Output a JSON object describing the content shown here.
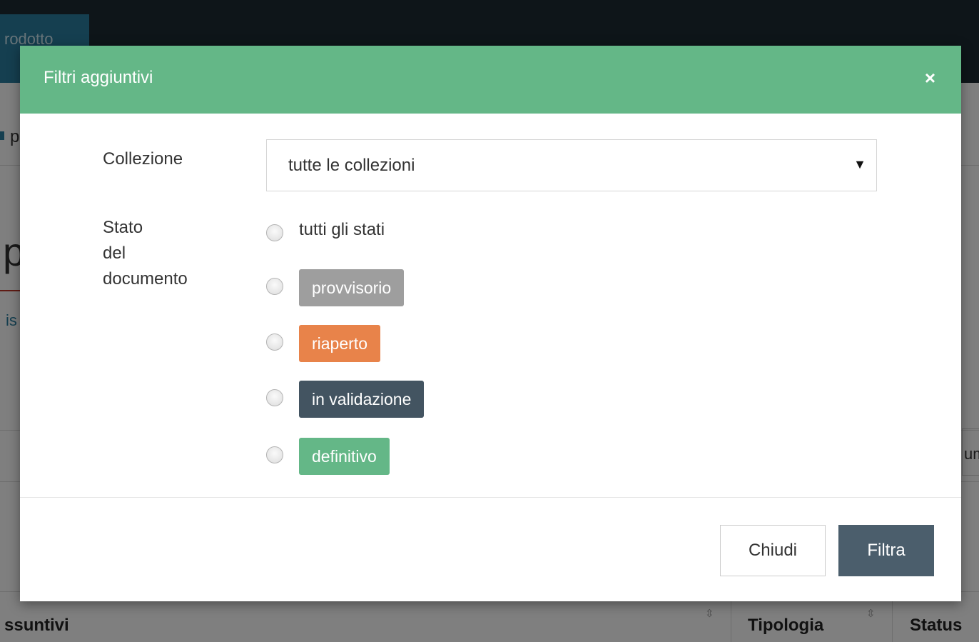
{
  "background": {
    "tab_label": "rodotto",
    "letter_p": "p",
    "big_letter": "p",
    "link_fragment": "is",
    "right_fragment": "um",
    "table_headers": [
      "ssuntivi",
      "Tipologia",
      "Status"
    ]
  },
  "modal": {
    "title": "Filtri aggiuntivi",
    "close_symbol": "×",
    "collezione": {
      "label": "Collezione",
      "selected": "tutte le collezioni",
      "caret": "▼"
    },
    "stato": {
      "label_lines": [
        "Stato",
        "del",
        "documento"
      ],
      "options": [
        {
          "label": "tutti gli stati",
          "style": "plain"
        },
        {
          "label": "provvisorio",
          "style": "badge",
          "color": "#9e9e9e"
        },
        {
          "label": "riaperto",
          "style": "badge",
          "color": "#e8834a"
        },
        {
          "label": "in validazione",
          "style": "badge",
          "color": "#435461"
        },
        {
          "label": "definitivo",
          "style": "badge",
          "color": "#64b787"
        }
      ]
    },
    "footer": {
      "close_label": "Chiudi",
      "filter_label": "Filtra"
    }
  },
  "colors": {
    "header": "#64b787",
    "primary_button": "#4b5e6c"
  }
}
